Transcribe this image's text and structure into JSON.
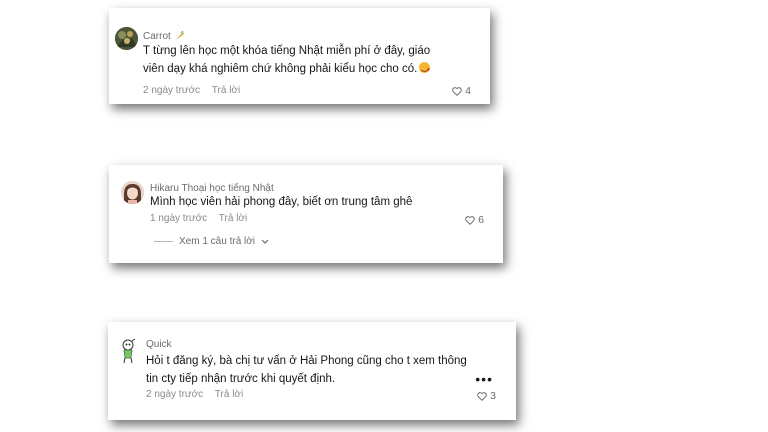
{
  "comments": [
    {
      "username": "Carrot",
      "username_badge_icon": "carrot-icon",
      "text": "T từng lên học một khóa tiếng Nhật miễn phí ở đây, giáo viên dạy khá nghiêm chứ không phải kiểu học cho có.",
      "trailing_emoji_icon": "heart-face-icon",
      "time": "2 ngày trước",
      "reply_label": "Trả lời",
      "likes": "4"
    },
    {
      "username": "Hikaru Thoại học tiếng Nhật",
      "text": "Mình học viên hải phong đây, biết ơn trung tâm ghê",
      "time": "1 ngày trước",
      "reply_label": "Trả lời",
      "likes": "6",
      "view_replies_label": "Xem 1 câu trả lời"
    },
    {
      "username": "Quick",
      "text": "Hỏi t đăng ký, bà chị tư vấn ở Hải Phong cũng cho t xem thông tin cty tiếp nhận trước khi quyết định.",
      "time": "2 ngày trước",
      "reply_label": "Trả lời",
      "likes": "3",
      "more_label": "•••"
    }
  ],
  "colors": {
    "text": "#161616",
    "muted": "#8a8a8a",
    "username": "#6b6b6b",
    "card_bg": "#ffffff"
  }
}
